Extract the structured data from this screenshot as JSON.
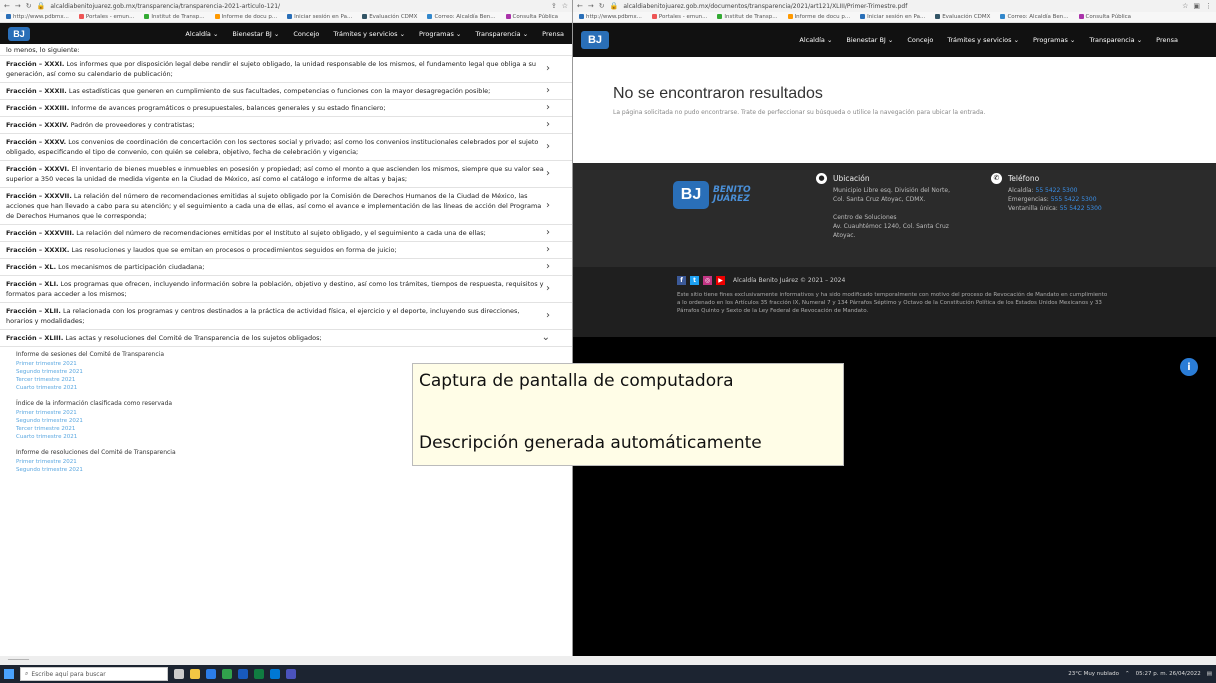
{
  "left_browser": {
    "url": "alcaldiabenitojuarez.gob.mx/transparencia/transparencia-2021-articulo-121/",
    "bookmarks": [
      "http://www.pdbmx...",
      "Portales - emun...",
      "Institut de Transp...",
      "Informe de docu p...",
      "Iniciar sesión en Pa...",
      "Evaluación CDMX",
      "Correo: Alcaldía Ben...",
      "Consulta Pública"
    ]
  },
  "right_browser": {
    "url": "alcaldiabenitojuarez.gob.mx/documentos/transparencia/2021/art121/XLIII/Primer-Trimestre.pdf",
    "bookmarks": [
      "http://www.pdbmx...",
      "Portales - emun...",
      "Institut de Transp...",
      "Informe de docu p...",
      "Iniciar sesión en Pa...",
      "Evaluación CDMX",
      "Correo: Alcaldía Ben...",
      "Consulta Pública"
    ]
  },
  "site": {
    "logo_text": "BJ",
    "nav": [
      "Alcaldía ⌄",
      "Bienestar BJ ⌄",
      "Concejo",
      "Trámites y servicios ⌄",
      "Programas ⌄",
      "Transparencia ⌄",
      "Prensa"
    ]
  },
  "fracciones": {
    "intro": "lo menos, lo siguiente:",
    "rows": [
      {
        "label": "Fracción – XXXI.",
        "text": " Los informes que por disposición legal debe rendir el sujeto obligado, la unidad responsable de los mismos, el fundamento legal que obliga a su generación, así como su calendario de publicación;"
      },
      {
        "label": "Fracción – XXXII.",
        "text": " Las estadísticas que generen en cumplimiento de sus facultades, competencias o funciones con la mayor desagregación posible;"
      },
      {
        "label": "Fracción – XXXIII.",
        "text": " Informe de avances programáticos o presupuestales, balances generales y su estado financiero;"
      },
      {
        "label": "Fracción – XXXIV.",
        "text": " Padrón de proveedores y contratistas;"
      },
      {
        "label": "Fracción – XXXV.",
        "text": " Los convenios de coordinación de concertación con los sectores social y privado; así como los convenios institucionales celebrados por el sujeto obligado, especificando el tipo de convenio, con quién se celebra, objetivo, fecha de celebración y vigencia;"
      },
      {
        "label": "Fracción – XXXVI.",
        "text": " El inventario de bienes muebles e inmuebles en posesión y propiedad; así como el monto a que ascienden los mismos, siempre que su valor sea superior a 350 veces la unidad de medida vigente en la Ciudad de México, así como el catálogo e informe de altas y bajas;"
      },
      {
        "label": "Fracción – XXXVII.",
        "text": " La relación del número de recomendaciones emitidas al sujeto obligado por la Comisión de Derechos Humanos de la Ciudad de México, las acciones que han llevado a cabo para su atención; y el seguimiento a cada una de ellas, así como el avance e implementación de las líneas de acción del Programa de Derechos Humanos que le corresponda;"
      },
      {
        "label": "Fracción – XXXVIII.",
        "text": " La relación del número de recomendaciones emitidas por el Instituto al sujeto obligado, y el seguimiento a cada una de ellas;"
      },
      {
        "label": "Fracción – XXXIX.",
        "text": " Las resoluciones y laudos que se emitan en procesos o procedimientos seguidos en forma de juicio;"
      },
      {
        "label": "Fracción – XL.",
        "text": " Los mecanismos de participación ciudadana;"
      },
      {
        "label": "Fracción – XLI.",
        "text": " Los programas que ofrecen, incluyendo información sobre la población, objetivo y destino, así como los trámites, tiempos de respuesta, requisitos y formatos para acceder a los mismos;"
      },
      {
        "label": "Fracción – XLII.",
        "text": " La relacionada con los programas y centros destinados a la práctica de actividad física, el ejercicio y el deporte, incluyendo sus direcciones, horarios y modalidades;"
      },
      {
        "label": "Fracción – XLIII.",
        "text": " Las actas y resoluciones del Comité de Transparencia de los sujetos obligados;"
      }
    ],
    "open_chevron": "⌄",
    "closed_chevron": "›",
    "sub_blocks": [
      {
        "title": "Informe de sesiones del Comité de Transparencia",
        "links": [
          "Primer trimestre 2021",
          "Segundo trimestre 2021",
          "Tercer trimestre 2021",
          "Cuarto trimestre 2021"
        ]
      },
      {
        "title": "Índice de la información clasificada como reservada",
        "links": [
          "Primer trimestre 2021",
          "Segundo trimestre 2021",
          "Tercer trimestre 2021",
          "Cuarto trimestre 2021"
        ]
      },
      {
        "title": "Informe de resoluciones del Comité de Transparencia",
        "links": [
          "Primer trimestre 2021",
          "Segundo trimestre 2021"
        ]
      }
    ]
  },
  "no_results": {
    "title": "No se encontraron resultados",
    "description": "La página solicitada no pudo encontrarse. Trate de perfeccionar su búsqueda o utilice la navegación para ubicar la entrada."
  },
  "footer": {
    "logo_line1": "BENITO",
    "logo_line2": "JUÁREZ",
    "location_title": "Ubicación",
    "location_lines": [
      "Municipio Libre esq. División del Norte,",
      "Col. Santa Cruz Atoyac, CDMX.",
      "",
      "Centro de Soluciones",
      "Av. Cuauhtémoc 1240, Col. Santa Cruz",
      "Atoyac."
    ],
    "phone_title": "Teléfono",
    "phone_lines": [
      {
        "label": "Alcaldía: ",
        "value": "55 5422 5300"
      },
      {
        "label": "Emergencias: ",
        "value": "555 5422 5300"
      },
      {
        "label": "Ventanilla única: ",
        "value": "55 5422 5300"
      }
    ],
    "copyright": "Alcaldía Benito Juárez © 2021 – 2024",
    "legal": "Este sitio tiene fines exclusivamente informativos y ha sido modificado temporalmente con motivo del proceso de Revocación de Mandato en cumplimiento a lo ordenado en los Artículos 35 fracción IX, Numeral 7 y 134 Párrafos Séptimo y Octavo de la Constitución Política de los Estados Unidos Mexicanos y 33 Párrafos Quinto y Sexto de la Ley Federal de Revocación de Mandato."
  },
  "tooltip": {
    "line1": "Captura de pantalla de computadora",
    "line2": "Descripción generada automáticamente"
  },
  "taskbar": {
    "search_placeholder": "Escribe aquí para buscar",
    "weather": "23°C Muy nublado",
    "time": "05:27 p. m.",
    "date": "26/04/2022"
  },
  "colors": {
    "link": "#5aa7e0",
    "brand_blue": "#2a6fb8",
    "site_header": "#111111",
    "footer": "#2b2b2b"
  }
}
